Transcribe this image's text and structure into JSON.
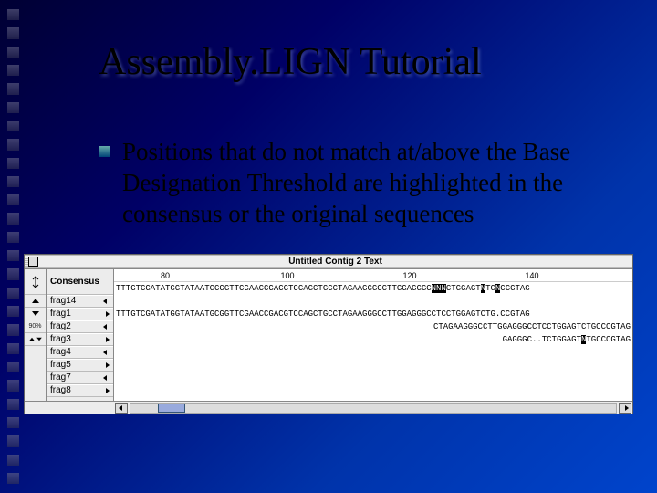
{
  "slide": {
    "title": "Assembly.LIGN Tutorial",
    "bullet_text": "Positions that do not match at/above the Base Designation Threshold are highlighted in the consensus or the original sequences"
  },
  "window": {
    "title": "Untitled Contig 2 Text",
    "quality_label": "90%",
    "ruler": {
      "ticks": [
        "80",
        "100",
        "120",
        "140"
      ]
    },
    "rows": [
      {
        "name": "Consensus",
        "consensus": true,
        "seq_pre": "TTTGTCGATATGGTATAATGCGGTTCGAACCGACGTCCAGCTGCCTAGAAGGGCCTTGGAGGGC",
        "hl1": "NNN",
        "seq_mid": "CTGGAGT",
        "hl2": "N",
        "seq_mid2": "TG",
        "hl3": "N",
        "seq_post": "CCGTAG"
      },
      {
        "name": "frag14",
        "seq": ""
      },
      {
        "name": "frag1",
        "seq": "TTTGTCGATATGGTATAATGCGGTTCGAACCGACGTCCAGCTGCCTAGAAGGGCCTTGGAGGGCCTCCTGGAGTCTG.CCGTAG"
      },
      {
        "name": "frag2",
        "seq_indent": 42,
        "seq": "CTAGAAGGGCCTTGGAGGGCCTCCTGGAGTCTGCCCGTAG"
      },
      {
        "name": "frag3",
        "seq_indent": 52,
        "seq_pre": "GAGGGC..TCTGGAGT",
        "hl1": "N",
        "seq_post": "TGCCCGTAG"
      },
      {
        "name": "frag4",
        "seq": ""
      },
      {
        "name": "frag5",
        "seq": ""
      },
      {
        "name": "frag7",
        "seq": ""
      },
      {
        "name": "frag8",
        "seq": ""
      }
    ]
  }
}
